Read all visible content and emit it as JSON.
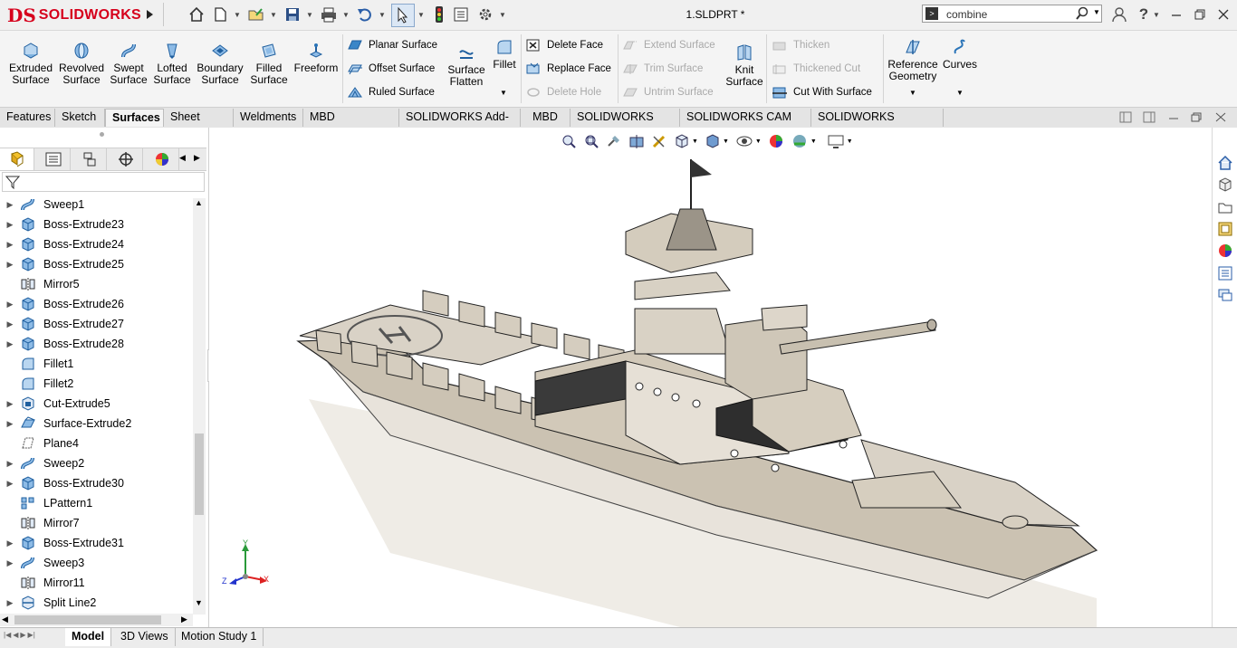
{
  "app": {
    "brand_prefix": "DS",
    "brand_name": "SOLIDWORKS",
    "document_title": "1.SLDPRT *"
  },
  "search": {
    "value": "combine"
  },
  "command_manager": {
    "big_buttons": [
      {
        "label_1": "Extruded",
        "label_2": "Surface",
        "icon": "extruded-surface-icon"
      },
      {
        "label_1": "Revolved",
        "label_2": "Surface",
        "icon": "revolved-surface-icon"
      },
      {
        "label_1": "Swept",
        "label_2": "Surface",
        "icon": "swept-surface-icon"
      },
      {
        "label_1": "Lofted",
        "label_2": "Surface",
        "icon": "lofted-surface-icon"
      },
      {
        "label_1": "Boundary",
        "label_2": "Surface",
        "icon": "boundary-surface-icon"
      },
      {
        "label_1": "Filled",
        "label_2": "Surface",
        "icon": "filled-surface-icon"
      },
      {
        "label_1": "Freeform",
        "label_2": "",
        "icon": "freeform-icon"
      }
    ],
    "group_a": [
      "Planar Surface",
      "Offset Surface",
      "Ruled Surface"
    ],
    "surface_flatten": {
      "label_1": "Surface",
      "label_2": "Flatten"
    },
    "fillet": {
      "label": "Fillet"
    },
    "group_b": [
      "Delete Face",
      "Replace Face",
      "Delete Hole"
    ],
    "group_c": [
      "Extend Surface",
      "Trim Surface",
      "Untrim Surface"
    ],
    "knit_surface": {
      "label_1": "Knit",
      "label_2": "Surface"
    },
    "group_d": [
      "Thicken",
      "Thickened Cut",
      "Cut With Surface"
    ],
    "reference_geometry": {
      "label_1": "Reference",
      "label_2": "Geometry"
    },
    "curves": {
      "label": "Curves"
    }
  },
  "tabs": [
    "Features",
    "Sketch",
    "Surfaces",
    "Sheet Metal",
    "Weldments",
    "MBD Dimensions",
    "SOLIDWORKS Add-Ins",
    "MBD",
    "SOLIDWORKS CAM",
    "SOLIDWORKS CAM TBM",
    "SOLIDWORKS Inspection"
  ],
  "active_tab": "Surfaces",
  "feature_tree": [
    {
      "label": "Sweep1",
      "icon": "sweep",
      "expandable": true
    },
    {
      "label": "Boss-Extrude23",
      "icon": "extrude",
      "expandable": true
    },
    {
      "label": "Boss-Extrude24",
      "icon": "extrude",
      "expandable": true
    },
    {
      "label": "Boss-Extrude25",
      "icon": "extrude",
      "expandable": true
    },
    {
      "label": "Mirror5",
      "icon": "mirror",
      "expandable": false
    },
    {
      "label": "Boss-Extrude26",
      "icon": "extrude",
      "expandable": true
    },
    {
      "label": "Boss-Extrude27",
      "icon": "extrude",
      "expandable": true
    },
    {
      "label": "Boss-Extrude28",
      "icon": "extrude",
      "expandable": true
    },
    {
      "label": "Fillet1",
      "icon": "fillet",
      "expandable": false
    },
    {
      "label": "Fillet2",
      "icon": "fillet",
      "expandable": false
    },
    {
      "label": "Cut-Extrude5",
      "icon": "cut",
      "expandable": true
    },
    {
      "label": "Surface-Extrude2",
      "icon": "surface",
      "expandable": true
    },
    {
      "label": "Plane4",
      "icon": "plane",
      "expandable": false
    },
    {
      "label": "Sweep2",
      "icon": "sweep",
      "expandable": true
    },
    {
      "label": "Boss-Extrude30",
      "icon": "extrude",
      "expandable": true
    },
    {
      "label": "LPattern1",
      "icon": "pattern",
      "expandable": false
    },
    {
      "label": "Mirror7",
      "icon": "mirror",
      "expandable": false
    },
    {
      "label": "Boss-Extrude31",
      "icon": "extrude",
      "expandable": true
    },
    {
      "label": "Sweep3",
      "icon": "sweep",
      "expandable": true
    },
    {
      "label": "Mirror11",
      "icon": "mirror",
      "expandable": false
    },
    {
      "label": "Split Line2",
      "icon": "split",
      "expandable": true
    }
  ],
  "bottom_tabs": [
    "Model",
    "3D Views",
    "Motion Study 1"
  ],
  "active_bottom_tab": "Model",
  "triad": {
    "x": "X",
    "y": "Y",
    "z": "Z"
  },
  "colors": {
    "brand_red": "#d6001c",
    "icon_blue": "#2a74b8",
    "hull": "#cfc6b6"
  }
}
